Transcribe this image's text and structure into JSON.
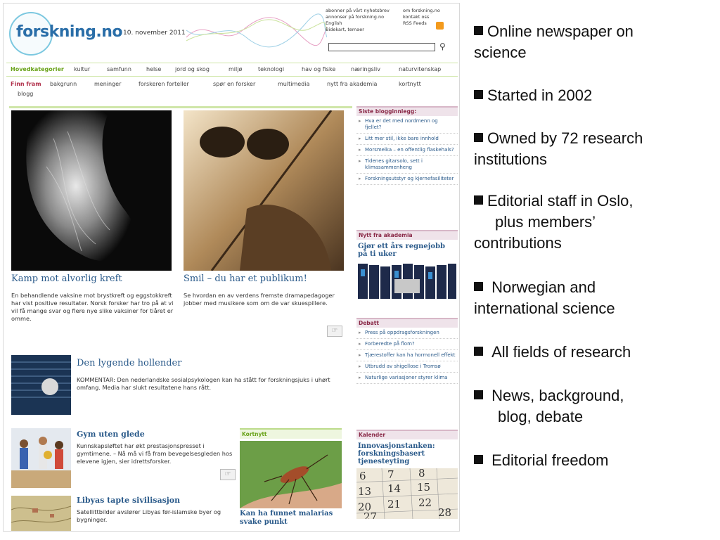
{
  "site": {
    "logo": "forskning.no",
    "date": "10. november 2011",
    "header_links_left": [
      "abonner på vårt nyhetsbrev",
      "annonser på forskning.no",
      "English",
      "Bidekart, temaer"
    ],
    "header_links_right": [
      "om forskning.no",
      "kontakt oss",
      "RSS Feeds"
    ],
    "nav_label": "Hovedkategorier",
    "nav_items": [
      "kultur",
      "samfunn",
      "helse",
      "jord og skog",
      "miljø",
      "teknologi",
      "hav og fiske",
      "næringsliv",
      "naturvitenskap"
    ],
    "finn_label": "Finn fram",
    "finn_items": [
      "bakgrunn",
      "meninger",
      "forskeren forteller",
      "spør en forsker",
      "multimedia",
      "nytt fra akademia",
      "kortnytt",
      "blogg"
    ],
    "story1": {
      "title": "Kamp mot alvorlig kreft",
      "text": "En behandlende vaksine mot brystkreft og eggstokkreft har vist positive resultater. Norsk forsker har tro på at vi vil få mange svar og flere nye slike vaksiner for tiåret er omme."
    },
    "story2": {
      "title": "Smil – du har et publikum!",
      "text": "Se hvordan en av verdens fremste dramapedagoger jobber med musikere som om de var skuespillere."
    },
    "story3": {
      "title": "Den lygende hollender",
      "text": "KOMMENTAR: Den nederlandske sosialpsykologen kan ha stått for forskningsjuks i uhørt omfang. Media har slukt resultatene hans rått."
    },
    "story4": {
      "title": "Gym uten glede",
      "text": "Kunnskapsløftet har økt prestasjonspresset i gymtimene. – Nå må vi få fram bevegelsesgleden hos elevene igjen, sier idrettsforsker."
    },
    "story5": {
      "title": "Libyas tapte sivilisasjon",
      "text": "Satellittbilder avslører Libyas før-islamske byer og bygninger."
    },
    "kortnytt": {
      "header": "Kortnytt",
      "title": "Kan ha funnet malarias svake punkt"
    },
    "blog": {
      "header": "Siste blogginnlegg:",
      "entries": [
        "Hva er det med nordmenn og fjellet?",
        "Litt mer stil, ikke bare innhold",
        "Morsmelka – en offentlig flaskehals?",
        "Tidenes gitarsolo, sett i klimasammenheng",
        "Forskningsutstyr og kjernefasiliteter"
      ]
    },
    "akademia": {
      "header": "Nytt fra akademia",
      "title": "Gjør ett års regnejobb på ti uker"
    },
    "debatt": {
      "header": "Debatt",
      "entries": [
        "Press på oppdragsforskningen",
        "Forberedte på flom?",
        "Tjærestoffer kan ha hormonell effekt",
        "Utbrudd av shigellose i Tromsø",
        "Naturlige variasjoner styrer klima"
      ]
    },
    "kalender": {
      "header": "Kalender",
      "title": "Innovasjonstanken: forskningsbasert tjenesteyting"
    }
  },
  "bullets": [
    [
      "Online newspaper on",
      "science"
    ],
    [
      "Started in 2002"
    ],
    [
      "Owned by 72 research",
      "institutions"
    ],
    [
      "Editorial staff in Oslo,",
      "plus members’",
      "contributions"
    ],
    [
      "Norwegian and",
      "international science"
    ],
    [
      "All fields of research"
    ],
    [
      "News, background,",
      "blog, debate"
    ],
    [
      "Editorial freedom"
    ]
  ]
}
